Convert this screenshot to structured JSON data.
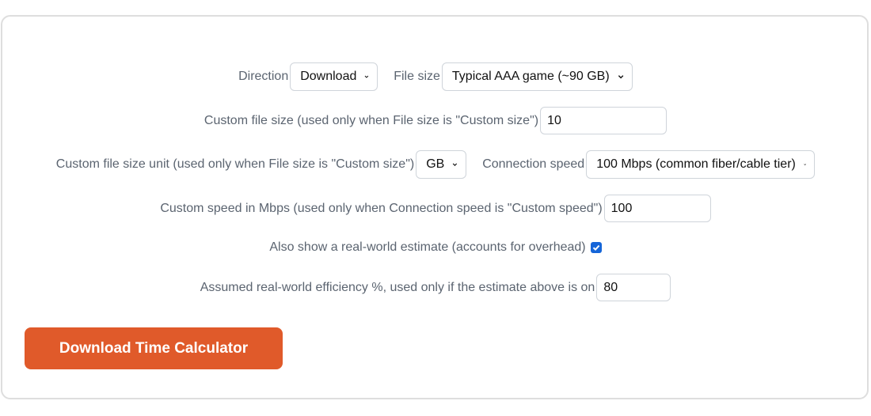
{
  "form": {
    "direction": {
      "label": "Direction",
      "selected": "Download"
    },
    "file_size": {
      "label": "File size",
      "selected": "Typical AAA game (~90 GB)"
    },
    "custom_file_size": {
      "label": "Custom file size (used only when File size is \"Custom size\")",
      "value": "10"
    },
    "custom_file_size_unit": {
      "label": "Custom file size unit (used only when File size is \"Custom size\")",
      "selected": "GB"
    },
    "connection_speed": {
      "label": "Connection speed",
      "selected": "100 Mbps (common fiber/cable tier)"
    },
    "custom_speed": {
      "label": "Custom speed in Mbps (used only when Connection speed is \"Custom speed\")",
      "value": "100"
    },
    "real_world_estimate": {
      "label": "Also show a real-world estimate (accounts for overhead)",
      "checked": true
    },
    "efficiency": {
      "label": "Assumed real-world efficiency %, used only if the estimate above is on",
      "value": "80"
    }
  },
  "submit": {
    "label": "Download Time Calculator"
  },
  "colors": {
    "button": "#e05a2a",
    "checkbox": "#1565d8",
    "label_text": "#5b6470",
    "border": "#cfd4da"
  }
}
